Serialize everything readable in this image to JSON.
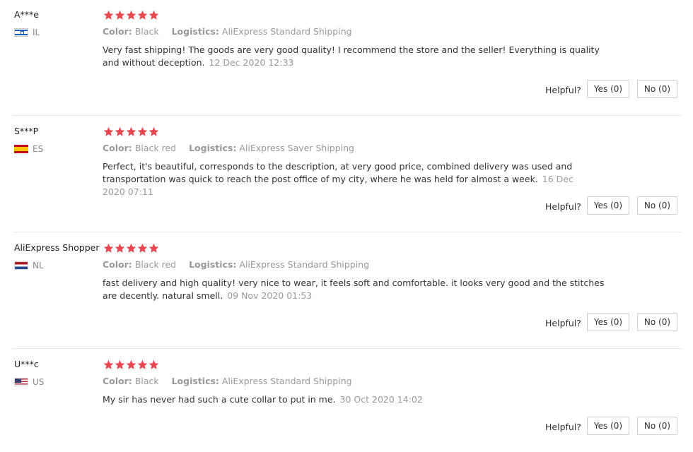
{
  "labels": {
    "color": "Color:",
    "logistics": "Logistics:",
    "helpful": "Helpful?"
  },
  "colors": {
    "star": "#e8474f",
    "muted": "#999999",
    "text": "#333333"
  },
  "reviews": [
    {
      "name": "A***e",
      "country": "IL",
      "flag": "israel-flag-icon",
      "rating": 5,
      "color": "Black",
      "logistics": "AliExpress Standard Shipping",
      "text": "Very fast shipping! The goods are very good quality! I recommend the store and the seller! Everything is quality and without deception.",
      "date": "12 Dec 2020 12:33",
      "yes": "Yes (0)",
      "no": "No (0)"
    },
    {
      "name": "S***P",
      "country": "ES",
      "flag": "spain-flag-icon",
      "rating": 5,
      "color": "Black red",
      "logistics": "AliExpress Saver Shipping",
      "text": "Perfect, it's beautiful, corresponds to the description, at very good price, combined delivery was used and transportation was quick to reach the post office of my city, where he was held for almost a week.",
      "date": "16 Dec 2020 07:11",
      "yes": "Yes (0)",
      "no": "No (0)"
    },
    {
      "name": "AliExpress Shopper",
      "country": "NL",
      "flag": "netherlands-flag-icon",
      "rating": 5,
      "color": "Black red",
      "logistics": "AliExpress Standard Shipping",
      "text": "fast delivery and high quality! very nice to wear, it feels soft and comfortable. it looks very good and the stitches are decently. natural smell.",
      "date": "09 Nov 2020 01:53",
      "yes": "Yes (0)",
      "no": "No (0)"
    },
    {
      "name": "U***c",
      "country": "US",
      "flag": "usa-flag-icon",
      "rating": 5,
      "color": "Black",
      "logistics": "AliExpress Standard Shipping",
      "text": "My sir has never had such a cute collar to put in me.",
      "date": "30 Oct 2020 14:02",
      "yes": "Yes (0)",
      "no": "No (0)"
    }
  ]
}
